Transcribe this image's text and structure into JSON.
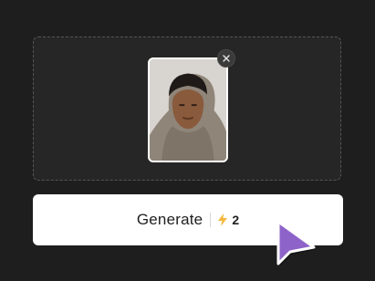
{
  "generate_button": {
    "label": "Generate",
    "credit_cost": "2"
  },
  "icons": {
    "remove": "close-icon",
    "credit": "lightning-bolt-icon",
    "pointer": "cursor-arrow-icon"
  },
  "colors": {
    "background": "#1e1e1e",
    "dropzone": "#262626",
    "button": "#ffffff",
    "bolt": "#f5b73b",
    "cursor": "#8e63c9"
  }
}
